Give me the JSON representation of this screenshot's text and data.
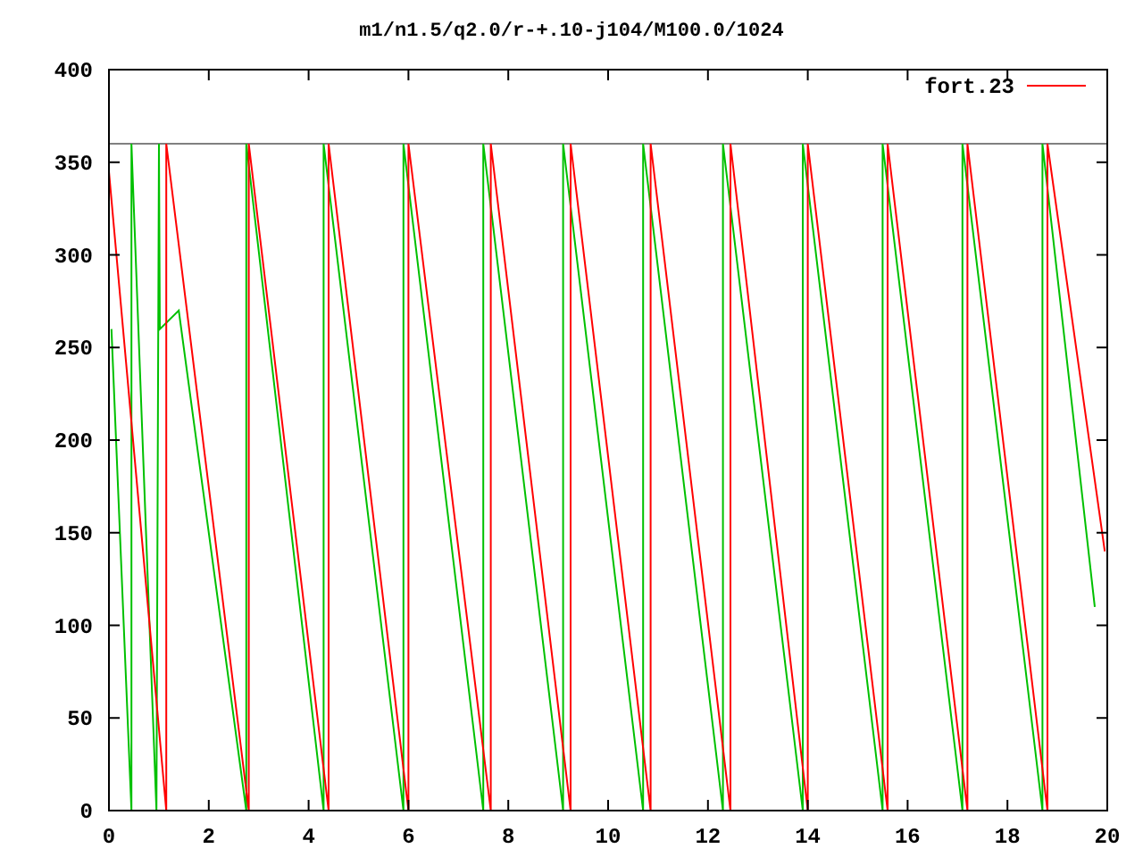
{
  "chart": {
    "title": "m1/n1.5/q2.0/r-+.10-j104/M100.0/1024",
    "chart_data": {
      "type": "line",
      "xlim": [
        0,
        20
      ],
      "ylim": [
        0,
        400
      ],
      "xticks": [
        0,
        2,
        4,
        6,
        8,
        10,
        12,
        14,
        16,
        18,
        20
      ],
      "yticks": [
        0,
        50,
        100,
        150,
        200,
        250,
        300,
        350,
        400
      ],
      "series": [
        {
          "name": "fort.23",
          "color": "#ff0000",
          "x": [
            0,
            1.15,
            1.15,
            2.8,
            2.8,
            4.4,
            4.4,
            6.0,
            6.0,
            7.65,
            7.65,
            9.25,
            9.25,
            10.85,
            10.85,
            12.45,
            12.45,
            14.0,
            14.0,
            15.6,
            15.6,
            17.2,
            17.2,
            18.8,
            18.8,
            19.95
          ],
          "values": [
            345,
            0,
            360,
            0,
            360,
            0,
            360,
            0,
            360,
            0,
            360,
            0,
            360,
            0,
            360,
            0,
            360,
            0,
            360,
            0,
            360,
            0,
            360,
            0,
            360,
            140
          ]
        },
        {
          "color": "#00c000",
          "x": [
            0.05,
            0.45,
            0.45,
            0.95,
            1.0,
            1.02,
            1.4,
            1.6,
            2.75,
            2.75,
            4.3,
            4.3,
            5.9,
            5.9,
            7.5,
            7.5,
            9.1,
            9.1,
            10.7,
            10.7,
            12.3,
            12.3,
            13.9,
            13.9,
            15.5,
            15.5,
            17.1,
            17.1,
            18.7,
            18.7,
            19.75
          ],
          "values": [
            260,
            0,
            360,
            0,
            360,
            260,
            270,
            230,
            0,
            360,
            0,
            360,
            0,
            360,
            0,
            360,
            0,
            360,
            0,
            360,
            0,
            360,
            0,
            360,
            0,
            360,
            0,
            360,
            0,
            360,
            110
          ]
        },
        {
          "color": "#808080",
          "x": [
            0,
            20
          ],
          "values": [
            360,
            360
          ]
        }
      ]
    }
  }
}
